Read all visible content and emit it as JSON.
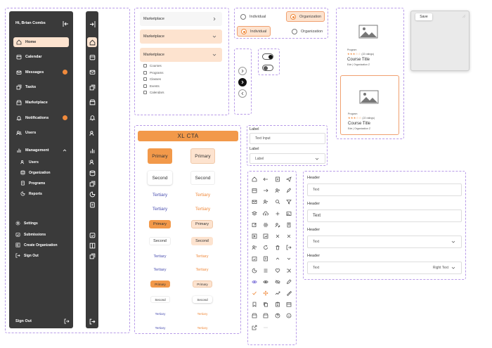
{
  "sidebar": {
    "greeting": "Hi, Brian Combs",
    "items": [
      {
        "label": "Home",
        "active": true
      },
      {
        "label": "Calendar"
      },
      {
        "label": "Messages",
        "badge": true
      },
      {
        "label": "Tasks"
      },
      {
        "label": "Marketplace"
      },
      {
        "label": "Notifications",
        "badge": true
      },
      {
        "label": "Users"
      },
      {
        "label": "Management"
      }
    ],
    "sub_items": [
      "Users",
      "Organization",
      "Programs",
      "Reports"
    ],
    "bottom_items": [
      "Settings",
      "Submissions",
      "Create Organization",
      "Sign Out"
    ],
    "footer": "Sign Out"
  },
  "dropdowns": {
    "d1": "Marketplace",
    "d2": "Marketplace",
    "d3": "Marketplace",
    "options": [
      "Courses",
      "Programs",
      "Classes",
      "Events",
      "Calendars"
    ]
  },
  "radios": {
    "r1": "Individual",
    "r2": "Organization",
    "r3": "Individual",
    "r4": "Organization"
  },
  "cards": [
    {
      "tag": "Program",
      "rating": "(22 ratings)",
      "title": "Course Title",
      "meta": "Ede  |  Organization Z"
    },
    {
      "tag": "Program",
      "rating": "(22 ratings)",
      "title": "Course Title",
      "meta": "Ede  |  Organization Z"
    }
  ],
  "modal": {
    "save": "Save"
  },
  "cta": {
    "xl": "XL CTA"
  },
  "buttons": {
    "primary": "Primary",
    "second": "Second",
    "tertiary": "Tertiary"
  },
  "form_small": {
    "label1": "Label",
    "input1": "Text Input",
    "label2": "Label",
    "select": "Label"
  },
  "form_large": {
    "header1": "Header",
    "text1": "Text",
    "header2": "Header",
    "text2": "Text",
    "header3": "Header",
    "text3": "Text",
    "header4": "Header",
    "text4": "Text",
    "right4": "Right Text"
  },
  "colors": {
    "accent": "#f2994a",
    "accent_light": "#fde3cf",
    "tertiary": "#4a4fb0",
    "sidebar": "#3a3a3a"
  }
}
